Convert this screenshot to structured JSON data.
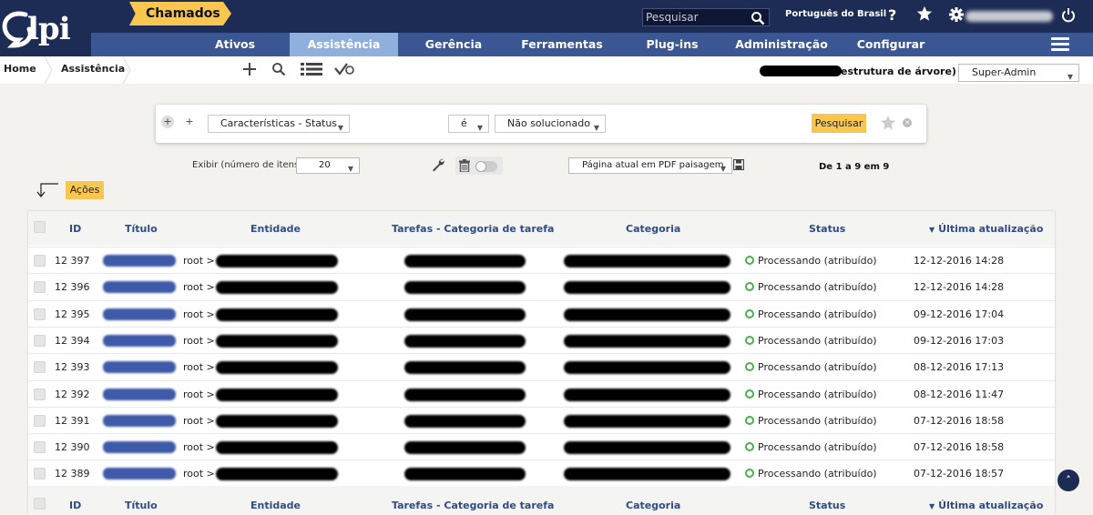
{
  "app": {
    "logo_text": "lpi"
  },
  "topbar": {
    "search_placeholder": "Pesquisar",
    "language": "Português do Brasil",
    "help_label": "?"
  },
  "nav": {
    "items": [
      {
        "label": "Ativos"
      },
      {
        "label": "Assistência"
      },
      {
        "label": "Gerência"
      },
      {
        "label": "Ferramentas"
      },
      {
        "label": "Plug-ins"
      },
      {
        "label": "Administração"
      },
      {
        "label": "Configurar"
      }
    ],
    "active_index": 1
  },
  "breadcrumb": {
    "home": "Home",
    "section": "Assistência",
    "current": "Chamados"
  },
  "entity": {
    "suffix": "estrutura de árvore)",
    "profile": "Super-Admin"
  },
  "criteria": {
    "field": "Características - Status",
    "operator": "é",
    "value": "Não solucionado",
    "search_button": "Pesquisar"
  },
  "display": {
    "label": "Exibir (número de itens)",
    "count": "20",
    "export_option": "Página atual em PDF paisagem",
    "pager": "De 1 a 9 em 9",
    "actions_button": "Ações"
  },
  "table": {
    "headers": {
      "id": "ID",
      "title": "Título",
      "entity": "Entidade",
      "tasks": "Tarefas - Categoria de tarefa",
      "category": "Categoria",
      "status": "Status",
      "updated": "Última atualização"
    },
    "rows": [
      {
        "id": "12 397",
        "entity_prefix": "root > ",
        "status": "Processando (atribuído)",
        "updated": "12-12-2016 14:28"
      },
      {
        "id": "12 396",
        "entity_prefix": "root > ",
        "status": "Processando (atribuído)",
        "updated": "12-12-2016 14:28"
      },
      {
        "id": "12 395",
        "entity_prefix": "root > ",
        "status": "Processando (atribuído)",
        "updated": "09-12-2016 17:04"
      },
      {
        "id": "12 394",
        "entity_prefix": "root > ",
        "status": "Processando (atribuído)",
        "updated": "09-12-2016 17:03"
      },
      {
        "id": "12 393",
        "entity_prefix": "root > ",
        "status": "Processando (atribuído)",
        "updated": "08-12-2016 17:13"
      },
      {
        "id": "12 392",
        "entity_prefix": "root > ",
        "status": "Processando (atribuído)",
        "updated": "08-12-2016 11:47"
      },
      {
        "id": "12 391",
        "entity_prefix": "root > ",
        "status": "Processando (atribuído)",
        "updated": "07-12-2016 18:58"
      },
      {
        "id": "12 390",
        "entity_prefix": "root > ",
        "status": "Processando (atribuído)",
        "updated": "07-12-2016 18:58"
      },
      {
        "id": "12 389",
        "entity_prefix": "root > ",
        "status": "Processando (atribuído)",
        "updated": "07-12-2016 18:57"
      }
    ]
  },
  "colors": {
    "topbar": "#1d2c55",
    "navbar": "#3a5693",
    "nav_active": "#8fb0dc",
    "accent_yellow": "#f9c74f",
    "header_text": "#2f4c87",
    "status_green": "#4cae4c"
  },
  "icons": [
    "search-icon",
    "star-icon",
    "gear-icon",
    "power-icon",
    "menu-icon",
    "add-icon",
    "search-tool-icon",
    "list-icon",
    "check-filter-icon",
    "wrench-icon",
    "trash-icon",
    "save-icon",
    "sort-desc-icon",
    "scroll-top-icon"
  ]
}
